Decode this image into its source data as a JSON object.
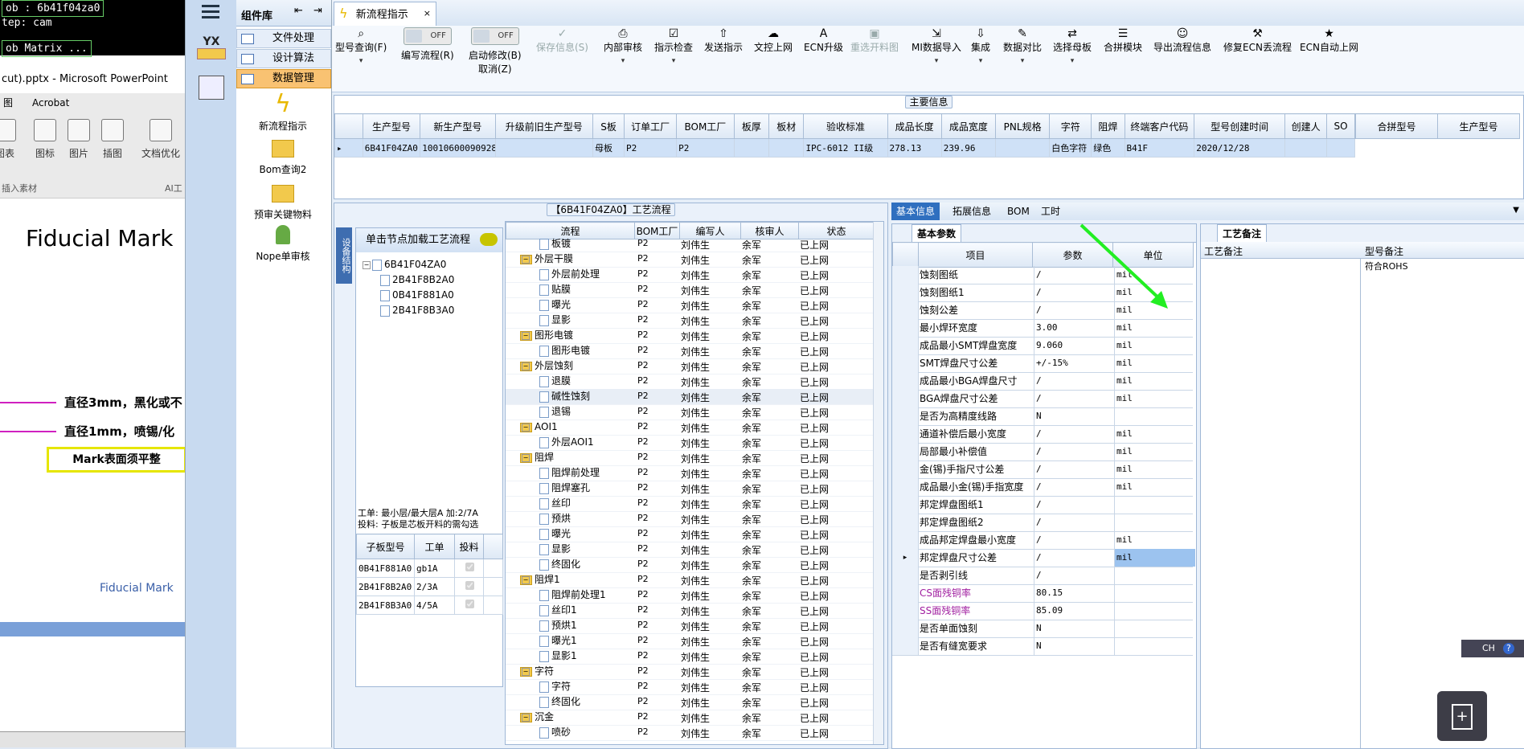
{
  "bg_app": {
    "term_lines": [
      "ob : 6b41f04za0",
      "tep: cam",
      "ob Matrix ..."
    ],
    "ppt_title": "cut).pptx - Microsoft PowerPoint",
    "ppt_tabs": [
      "图",
      "Acrobat"
    ],
    "ppt_tools": [
      "图表",
      "图标",
      "图片",
      "插图",
      "文档优化"
    ],
    "ppt_group": "插入素材",
    "ppt_group2": "AI工",
    "slide_title": "Fiducial Mark",
    "slide_line1": "直径3mm，黑化或不",
    "slide_line2": "直径1mm，喷锡/化",
    "slide_box": "Mark表面须平整",
    "slide_footer": "Fiducial Mark"
  },
  "strip": {
    "logo": "YX"
  },
  "comp_panel": {
    "title": "组件库",
    "items": [
      "文件处理",
      "设计算法",
      "数据管理"
    ],
    "tools": [
      "新流程指示",
      "Bom查询2",
      "预审关键物料",
      "Nope单审核"
    ]
  },
  "main": {
    "tab_title": "新流程指示",
    "toolbar": {
      "buttons": [
        "型号查询(F)",
        "编写流程(R)",
        "启动修改(B)",
        "取消(Z)",
        "保存信息(S)",
        "内部审核",
        "指示检查",
        "发送指示",
        "文控上网",
        "ECN升级",
        "重选开料图",
        "MI数据导入",
        "集成",
        "数据对比",
        "选择母板",
        "合拼模块",
        "导出流程信息",
        "修复ECN丢流程",
        "ECN自动上网"
      ],
      "toggle_off": "OFF"
    },
    "main_info": {
      "title": "主要信息",
      "columns": [
        "生产型号",
        "新生产型号",
        "升级前旧生产型号",
        "S板",
        "订单工厂",
        "BOM工厂",
        "板厚",
        "板材",
        "验收标准",
        "成品长度",
        "成品宽度",
        "PNL规格",
        "字符",
        "阻焊",
        "终端客户代码",
        "型号创建时间",
        "创建人",
        "SO"
      ],
      "row": [
        "6B41F04ZA0",
        "10010600090928",
        "",
        "母板",
        "P2",
        "P2",
        "",
        "",
        "IPC-6012 II级",
        "278.13",
        "239.96",
        "",
        "白色字符",
        "绿色",
        "B41F",
        "2020/12/28",
        "",
        ""
      ],
      "side_columns": [
        "合拼型号",
        "生产型号"
      ]
    },
    "process": {
      "title": "【6B41F04ZA0】工艺流程",
      "side_tab": "设备结构",
      "load_btn": "单击节点加载工艺流程",
      "tree": [
        "6B41F04ZA0",
        "2B41F8B2A0",
        "0B41F881A0",
        "2B41F8B3A0"
      ],
      "info1": "工单: 最小层/最大层A 加:2/7A",
      "info2": "投料: 子板是芯板开料的需勾选",
      "sub_columns": [
        "子板型号",
        "工单",
        "投料"
      ],
      "sub_rows": [
        [
          "0B41F881A0",
          "gb1A"
        ],
        [
          "2B41F8B2A0",
          "2/3A"
        ],
        [
          "2B41F8B3A0",
          "4/5A"
        ]
      ],
      "flow_columns": [
        "流程",
        "BOM工厂",
        "编写人",
        "核审人",
        "状态"
      ],
      "flow_rows": [
        {
          "name": "板镀",
          "lvl": 2,
          "t": "doc"
        },
        {
          "name": "外层干膜",
          "lvl": 1,
          "t": "folder"
        },
        {
          "name": "外层前处理",
          "lvl": 2,
          "t": "doc"
        },
        {
          "name": "贴膜",
          "lvl": 2,
          "t": "doc"
        },
        {
          "name": "曝光",
          "lvl": 2,
          "t": "doc"
        },
        {
          "name": "显影",
          "lvl": 2,
          "t": "doc"
        },
        {
          "name": "图形电镀",
          "lvl": 1,
          "t": "folder"
        },
        {
          "name": "图形电镀",
          "lvl": 2,
          "t": "doc"
        },
        {
          "name": "外层蚀刻",
          "lvl": 1,
          "t": "folder"
        },
        {
          "name": "退膜",
          "lvl": 2,
          "t": "doc"
        },
        {
          "name": "碱性蚀刻",
          "lvl": 2,
          "t": "doc"
        },
        {
          "name": "退锡",
          "lvl": 2,
          "t": "doc"
        },
        {
          "name": "AOI1",
          "lvl": 1,
          "t": "folder"
        },
        {
          "name": "外层AOI1",
          "lvl": 2,
          "t": "doc"
        },
        {
          "name": "阻焊",
          "lvl": 1,
          "t": "folder"
        },
        {
          "name": "阻焊前处理",
          "lvl": 2,
          "t": "doc"
        },
        {
          "name": "阻焊塞孔",
          "lvl": 2,
          "t": "doc"
        },
        {
          "name": "丝印",
          "lvl": 2,
          "t": "doc"
        },
        {
          "name": "预烘",
          "lvl": 2,
          "t": "doc"
        },
        {
          "name": "曝光",
          "lvl": 2,
          "t": "doc"
        },
        {
          "name": "显影",
          "lvl": 2,
          "t": "doc"
        },
        {
          "name": "终固化",
          "lvl": 2,
          "t": "doc"
        },
        {
          "name": "阻焊1",
          "lvl": 1,
          "t": "folder"
        },
        {
          "name": "阻焊前处理1",
          "lvl": 2,
          "t": "doc"
        },
        {
          "name": "丝印1",
          "lvl": 2,
          "t": "doc"
        },
        {
          "name": "预烘1",
          "lvl": 2,
          "t": "doc"
        },
        {
          "name": "曝光1",
          "lvl": 2,
          "t": "doc"
        },
        {
          "name": "显影1",
          "lvl": 2,
          "t": "doc"
        },
        {
          "name": "字符",
          "lvl": 1,
          "t": "folder"
        },
        {
          "name": "字符",
          "lvl": 2,
          "t": "doc"
        },
        {
          "name": "终固化",
          "lvl": 2,
          "t": "doc"
        },
        {
          "name": "沉金",
          "lvl": 1,
          "t": "folder"
        },
        {
          "name": "喷砂",
          "lvl": 2,
          "t": "doc"
        }
      ],
      "flow_bom": "P2",
      "flow_writer": "刘伟生",
      "flow_reviewer": "余军",
      "flow_status": "已上网"
    },
    "basic": {
      "tabs": [
        "基本信息",
        "拓展信息",
        "BOM",
        "工时"
      ],
      "sub_tab": "基本参数",
      "columns": [
        "项目",
        "参数",
        "单位"
      ],
      "rows": [
        [
          "蚀刻图纸",
          "/",
          "mil"
        ],
        [
          "蚀刻图纸1",
          "/",
          "mil"
        ],
        [
          "蚀刻公差",
          "/",
          "mil"
        ],
        [
          "最小焊环宽度",
          "3.00",
          "mil"
        ],
        [
          "成品最小SMT焊盘宽度",
          "9.060",
          "mil"
        ],
        [
          "SMT焊盘尺寸公差",
          "+/-15%",
          "mil"
        ],
        [
          "成品最小BGA焊盘尺寸",
          "/",
          "mil"
        ],
        [
          "BGA焊盘尺寸公差",
          "/",
          "mil"
        ],
        [
          "是否为高精度线路",
          "N",
          ""
        ],
        [
          "通道补偿后最小宽度",
          "/",
          "mil"
        ],
        [
          "局部最小补偿值",
          "/",
          "mil"
        ],
        [
          "金(锡)手指尺寸公差",
          "/",
          "mil"
        ],
        [
          "成品最小金(锡)手指宽度",
          "/",
          "mil"
        ],
        [
          "邦定焊盘图纸1",
          "/",
          ""
        ],
        [
          "邦定焊盘图纸2",
          "/",
          ""
        ],
        [
          "成品邦定焊盘最小宽度",
          "/",
          "mil"
        ],
        [
          "邦定焊盘尺寸公差",
          "/",
          "mil"
        ],
        [
          "是否剥引线",
          "/",
          ""
        ],
        [
          "CS面残铜率",
          "80.15",
          ""
        ],
        [
          "SS面残铜率",
          "85.09",
          ""
        ],
        [
          "是否单面蚀刻",
          "N",
          ""
        ],
        [
          "是否有缝宽要求",
          "N",
          ""
        ]
      ]
    },
    "remarks": {
      "tab": "工艺备注",
      "columns": [
        "工艺备注",
        "型号备注"
      ],
      "model_note": "符合ROHS"
    },
    "lang": "CH",
    "accent": "#2f6fbf",
    "highlight_color": "#a01fa0"
  }
}
